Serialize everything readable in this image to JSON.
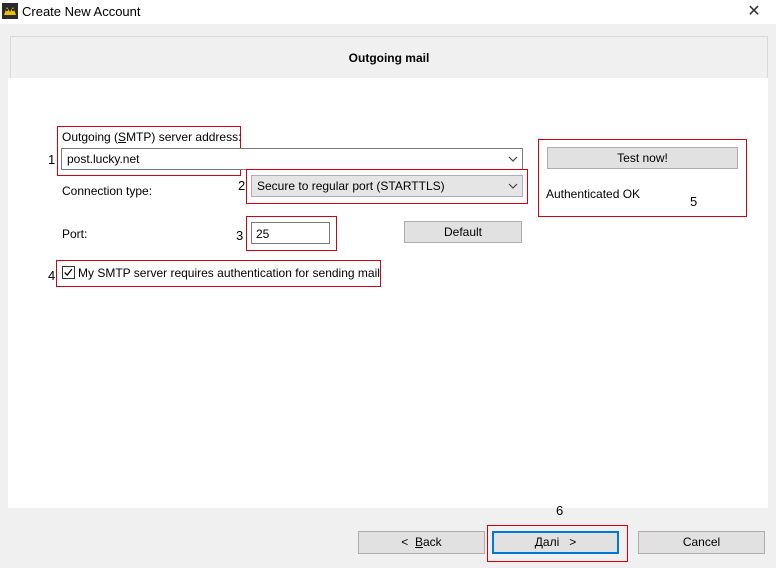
{
  "window": {
    "title": "Create New Account",
    "close_glyph": "✕"
  },
  "header": {
    "title": "Outgoing mail"
  },
  "markers": [
    "1",
    "2",
    "3",
    "4",
    "5",
    "6"
  ],
  "smtp": {
    "label_pre": "Outgoing (",
    "label_underlined": "S",
    "label_post": "MTP) server address:",
    "value": "post.lucky.net"
  },
  "connection": {
    "label": "Connection type:",
    "value": "Secure to regular port (STARTTLS)"
  },
  "port": {
    "label": "Port:",
    "value": "25",
    "default_button": "Default"
  },
  "auth": {
    "checked": true,
    "label": "My SMTP server requires authentication for sending mail"
  },
  "test": {
    "button": "Test now!",
    "status": "Authenticated OK"
  },
  "footer": {
    "back_pre": "<  ",
    "back_underlined": "B",
    "back_post": "ack",
    "next_pre": "",
    "next_underlined": "Д",
    "next_post": "алі   >",
    "cancel": "Cancel"
  },
  "colors": {
    "highlight": "#d6000f",
    "accent": "#0078d7"
  },
  "icons": [
    "app-icon",
    "close-icon",
    "chevron-down-icon",
    "checkmark-icon"
  ]
}
